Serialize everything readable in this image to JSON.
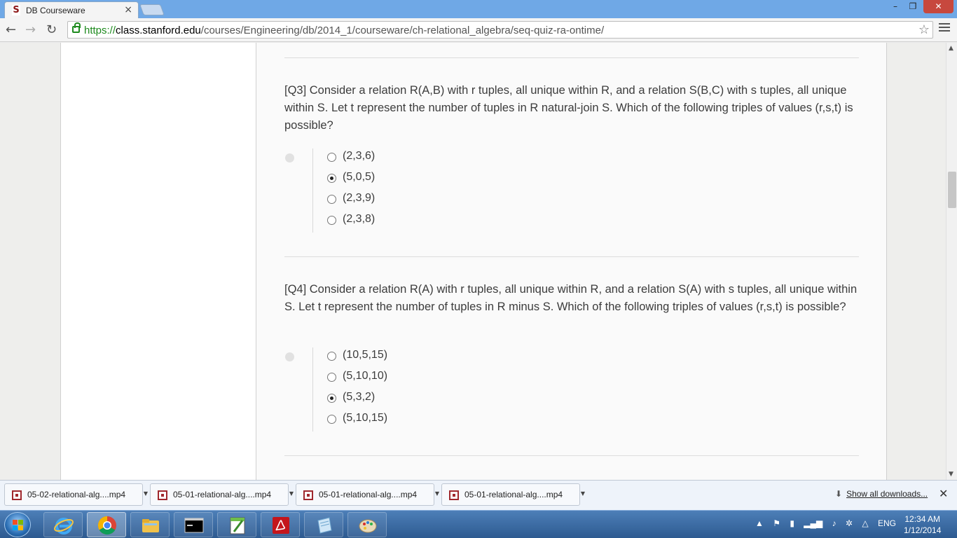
{
  "browser": {
    "tab_title": "DB Courseware",
    "tab_close": "×",
    "win_min": "–",
    "win_max": "❐",
    "win_close": "✕",
    "url_scheme": "https://",
    "url_host": "class.stanford.edu",
    "url_path": "/courses/Engineering/db/2014_1/courseware/ch-relational_algebra/seq-quiz-ra-ontime/"
  },
  "questions": [
    {
      "text": "[Q3] Consider a relation R(A,B) with r tuples, all unique within R, and a relation S(B,C) with s tuples, all unique within S. Let t represent the number of tuples in R natural-join S. Which of the following triples of values (r,s,t) is possible?",
      "choices": [
        "(2,3,6)",
        "(5,0,5)",
        "(2,3,9)",
        "(2,3,8)"
      ],
      "selected": 1
    },
    {
      "text": "[Q4] Consider a relation R(A) with r tuples, all unique within R, and a relation S(A) with s tuples, all unique within S. Let t represent the number of tuples in R minus S. Which of the following triples of values (r,s,t) is possible?",
      "choices": [
        "(10,5,15)",
        "(5,10,10)",
        "(5,3,2)",
        "(5,10,15)"
      ],
      "selected": 2
    }
  ],
  "downloads": {
    "items": [
      "05-02-relational-alg....mp4",
      "05-01-relational-alg....mp4",
      "05-01-relational-alg....mp4",
      "05-01-relational-alg....mp4"
    ],
    "show_all": "Show all downloads...",
    "close": "✕"
  },
  "taskbar": {
    "language": "ENG",
    "time": "12:34 AM",
    "date": "1/12/2014"
  },
  "colors": {
    "stanford_red": "#8c1515",
    "url_green": "#1e8a1e",
    "taskbar_blue": "#2d5a90"
  }
}
